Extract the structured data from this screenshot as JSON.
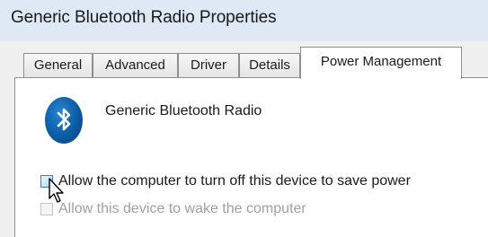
{
  "window": {
    "title": "Generic Bluetooth Radio Properties"
  },
  "tabs": [
    {
      "label": "General"
    },
    {
      "label": "Advanced"
    },
    {
      "label": "Driver"
    },
    {
      "label": "Details"
    },
    {
      "label": "Power Management",
      "active": true
    }
  ],
  "device": {
    "icon": "bluetooth-icon",
    "name": "Generic Bluetooth Radio"
  },
  "options": [
    {
      "label": "Allow the computer to turn off this device to save power",
      "checked": false,
      "enabled": true
    },
    {
      "label": "Allow this device to wake the computer",
      "checked": false,
      "enabled": false
    }
  ],
  "colors": {
    "title_bar": "#dfe9f5",
    "bluetooth_badge": "#0c5fa7"
  }
}
